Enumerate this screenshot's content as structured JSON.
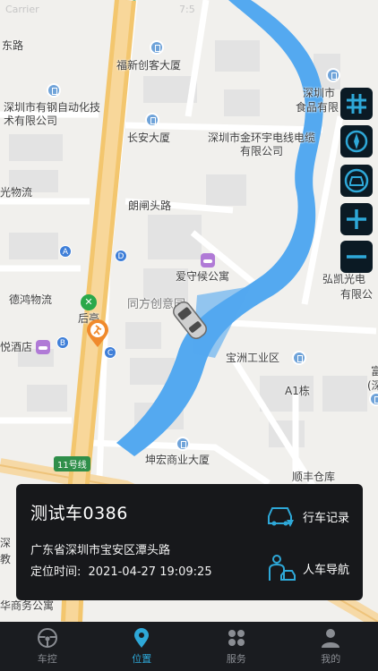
{
  "status_bar": {
    "carrier": "Carrier",
    "time": "7:5"
  },
  "map": {
    "labels": {
      "dongyi": "东路",
      "fuxin_plaza": "福新创客大厦",
      "youge": "深圳市有钢自动化技术有限公司",
      "changan": "长安大厦",
      "jinhuanyu": "深圳市金环宇电线电缆有限公司",
      "shenzhen_food": "深圳市",
      "food_co": "食品有限",
      "guang_logistics": "光物流",
      "langjiantou": "朗闸头路",
      "aishouhou": "爱守候公寓",
      "hongkai": "弘凯光电",
      "hongkai2": "有限公",
      "dehong": "德鸿物流",
      "houting": "后亭",
      "tongfang": "同方创意园",
      "yue_hotel": "悦酒店",
      "baozhou": "宝洲工业区",
      "a1": "A1栋",
      "fu": "富",
      "shen": "(深",
      "line11": "11号线",
      "kunhong": "坤宏商业大厦",
      "shunfeng": "顺丰仓库",
      "shen_left": "深",
      "jiao_left": "教",
      "huashang": "华商务公寓"
    },
    "exits": [
      "A",
      "B",
      "C",
      "D"
    ],
    "metro_symbol": "✕"
  },
  "controls": {
    "traffic": "traffic-grid-icon",
    "compass": "compass-icon",
    "car_view": "car-center-icon",
    "zoom_in": "plus-icon",
    "zoom_out": "minus-icon"
  },
  "vehicle_card": {
    "name": "测试车0386",
    "address": "广东省深圳市宝安区潭头路",
    "time_label": "定位时间:",
    "time_value": "2021-04-27 19:09:25",
    "trip_record": "行车记录",
    "navigation": "人车导航"
  },
  "tabs": [
    {
      "label": "车控",
      "icon": "steering-wheel-icon"
    },
    {
      "label": "位置",
      "icon": "location-pin-icon",
      "active": true
    },
    {
      "label": "服务",
      "icon": "grid-icon"
    },
    {
      "label": "我的",
      "icon": "user-icon"
    }
  ],
  "colors": {
    "accent": "#2ea8d8",
    "river": "#54a9f0",
    "highway": "#f2c56b",
    "card_bg": "#17181b"
  }
}
